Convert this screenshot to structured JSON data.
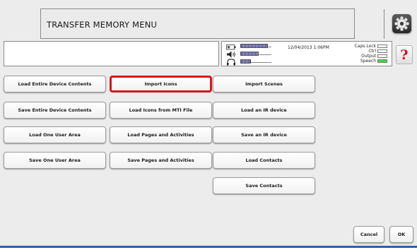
{
  "header": {
    "title": "TRANSFER MEMORY MENU"
  },
  "icons": {
    "settings": "gear-icon",
    "help": "question-mark-icon",
    "battery": "battery-icon",
    "volume": "speaker-icon",
    "headphones": "headphones-icon"
  },
  "status": {
    "datetime": "12/04/2013 1:06PM",
    "battery_level": 0.85,
    "volume_level": 0.55,
    "headphone_level": 0.3,
    "indicators": [
      {
        "label": "Caps Lock",
        "on": false
      },
      {
        "label": "Ctrl",
        "on": false
      },
      {
        "label": "Output",
        "on": false
      },
      {
        "label": "Speech",
        "on": true
      }
    ]
  },
  "help_label": "?",
  "buttons": {
    "load_entire_device": "Load Entire Device Contents",
    "save_entire_device": "Save Entire Device Contents",
    "load_one_user_area": "Load One User Area",
    "save_one_user_area": "Save One User Area",
    "import_icons": "Import Icons",
    "load_icons_mti": "Load Icons from MTI File",
    "load_pages_activities": "Load Pages and Activities",
    "save_pages_activities": "Save Pages and Activities",
    "import_scenes": "Import Scenes",
    "load_ir_device": "Load an IR device",
    "save_ir_device": "Save an IR device",
    "load_contacts": "Load Contacts",
    "save_contacts": "Save Contacts",
    "cancel": "Cancel",
    "ok": "OK"
  },
  "selected_button": "import_icons",
  "colors": {
    "selection_border": "#d51818",
    "speech_indicator": "#3ddc3d",
    "bottom_bar": "#2f5fa8"
  }
}
